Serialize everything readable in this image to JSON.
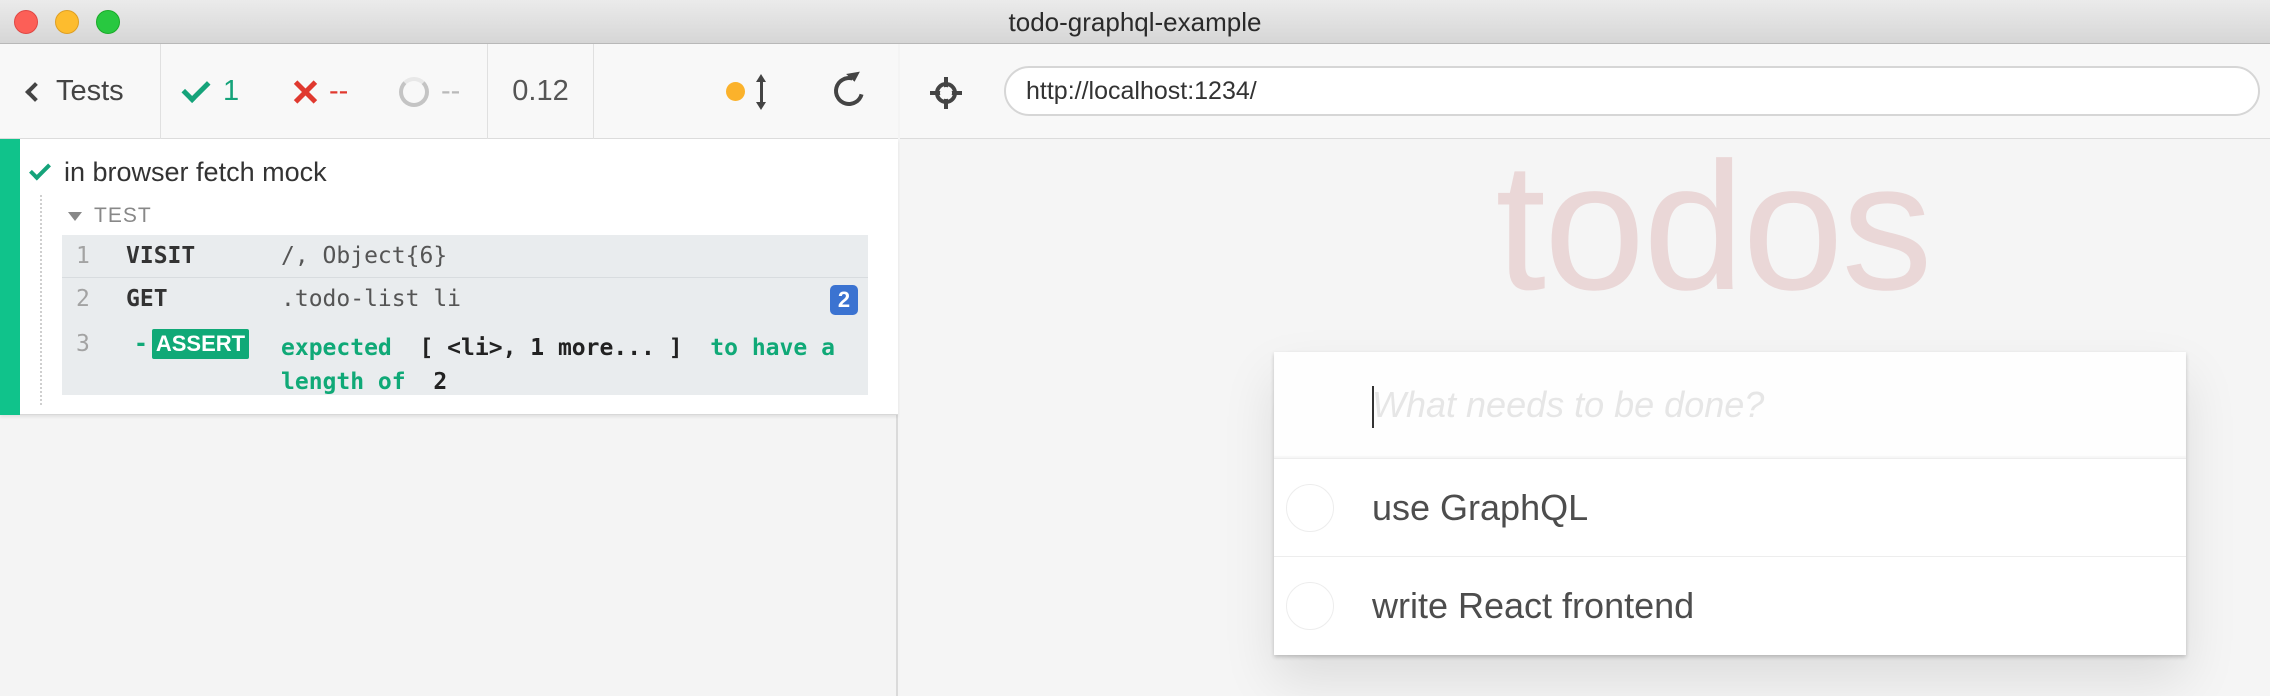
{
  "window": {
    "title": "todo-graphql-example"
  },
  "runner": {
    "tests_label": "Tests",
    "passed": "1",
    "failed": "--",
    "pending": "--",
    "duration": "0.12",
    "colors": {
      "pass": "#15a37a",
      "fail": "#e0392f",
      "running_dot": "#fbb22b"
    }
  },
  "reporter": {
    "test_title": "in browser fetch mock",
    "hook_label": "TEST",
    "commands": [
      {
        "num": "1",
        "name": "VISIT",
        "message": "/, Object{6}"
      },
      {
        "num": "2",
        "name": "GET",
        "message": ".todo-list li",
        "badge": "2"
      },
      {
        "num": "3",
        "prefix": "-",
        "name": "ASSERT",
        "msg_expected": "expected",
        "msg_subject": "[ <li>, 1 more... ]",
        "msg_to_have": "to have a",
        "msg_length_of": "length of",
        "msg_value": "2"
      }
    ]
  },
  "preview": {
    "url": "http://localhost:1234/",
    "app_title": "todos",
    "new_todo_placeholder": "What needs to be done?",
    "todos": [
      {
        "label": "use GraphQL",
        "completed": false
      },
      {
        "label": "write React frontend",
        "completed": false
      }
    ]
  }
}
